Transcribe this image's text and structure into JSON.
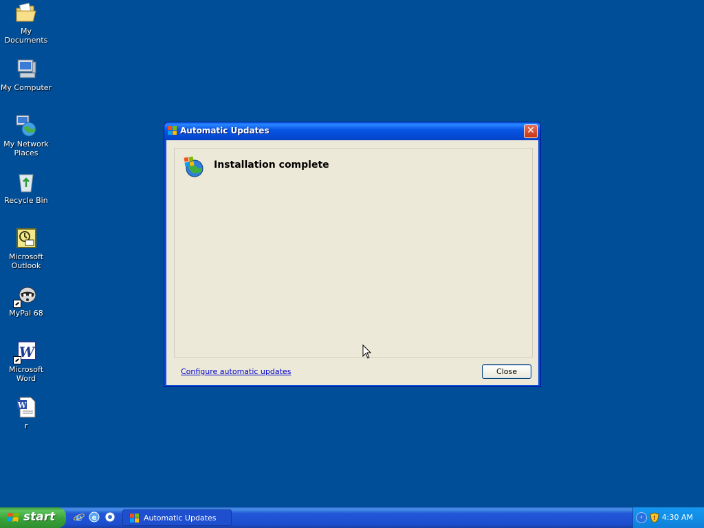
{
  "desktop_icons": [
    {
      "name": "my-documents",
      "label": "My Documents"
    },
    {
      "name": "my-computer",
      "label": "My Computer"
    },
    {
      "name": "my-network-places",
      "label": "My Network Places"
    },
    {
      "name": "recycle-bin",
      "label": "Recycle Bin"
    },
    {
      "name": "microsoft-outlook",
      "label": "Microsoft Outlook"
    },
    {
      "name": "mypal-68",
      "label": "MyPal 68"
    },
    {
      "name": "microsoft-word",
      "label": "Microsoft Word"
    },
    {
      "name": "r-document",
      "label": "r"
    }
  ],
  "dialog": {
    "title": "Automatic Updates",
    "headline": "Installation complete",
    "configure_link": "Configure automatic updates",
    "close_button": "Close"
  },
  "taskbar": {
    "start_label": "start",
    "task_label": "Automatic Updates",
    "clock": "4:30 AM"
  },
  "colors": {
    "desktop": "#004e98",
    "dialog_body": "#ece9d8",
    "title_blue": "#0856e6",
    "start_green": "#38a338"
  }
}
